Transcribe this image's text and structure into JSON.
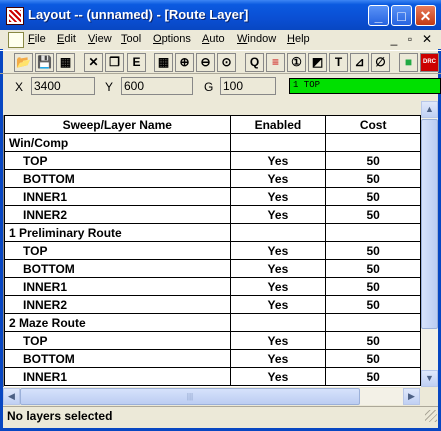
{
  "window": {
    "title": "Layout -- (unnamed) - [Route Layer]",
    "minimize_glyph": "_",
    "maximize_glyph": "□",
    "close_glyph": "✕"
  },
  "menu": {
    "items": [
      "File",
      "Edit",
      "View",
      "Tool",
      "Options",
      "Auto",
      "Window",
      "Help"
    ],
    "mdi_minimize": "_",
    "mdi_restore": "▫",
    "mdi_close": "✕"
  },
  "toolbar": {
    "tools": [
      {
        "name": "open-folder-icon",
        "glyph": "📂"
      },
      {
        "name": "save-icon",
        "glyph": "💾"
      },
      {
        "name": "print-icon",
        "glyph": "▦"
      },
      {
        "name": "cut-icon",
        "glyph": "✕"
      },
      {
        "name": "copy-icon",
        "glyph": "❐"
      },
      {
        "name": "spreadsheet-icon",
        "glyph": "E"
      },
      {
        "name": "grid-icon",
        "glyph": "▦"
      },
      {
        "name": "zoom-in-icon",
        "glyph": "⊕"
      },
      {
        "name": "zoom-out-icon",
        "glyph": "⊖"
      },
      {
        "name": "zoom-fit-icon",
        "glyph": "⊙"
      },
      {
        "name": "query-icon",
        "glyph": "Q"
      },
      {
        "name": "route-layer-icon",
        "glyph": "≡"
      },
      {
        "name": "pin-icon",
        "glyph": "①"
      },
      {
        "name": "shape-icon",
        "glyph": "◩"
      },
      {
        "name": "text-icon",
        "glyph": "T"
      },
      {
        "name": "measure-icon",
        "glyph": "⊿"
      },
      {
        "name": "no-connect-icon",
        "glyph": "∅"
      },
      {
        "name": "color-icon",
        "glyph": "■"
      },
      {
        "name": "drc-icon",
        "glyph": "DRC"
      }
    ]
  },
  "coords": {
    "x_label": "X",
    "x_value": "3400",
    "y_label": "Y",
    "y_value": "600",
    "g_label": "G",
    "g_value": "100",
    "layer": "1 TOP",
    "layer_color": "#00e000"
  },
  "table": {
    "headers": [
      "Sweep/Layer Name",
      "Enabled",
      "Cost"
    ],
    "rows": [
      {
        "name": "Win/Comp",
        "group": true,
        "enabled": "",
        "cost": ""
      },
      {
        "name": "TOP",
        "group": false,
        "enabled": "Yes",
        "cost": "50"
      },
      {
        "name": "BOTTOM",
        "group": false,
        "enabled": "Yes",
        "cost": "50"
      },
      {
        "name": "INNER1",
        "group": false,
        "enabled": "Yes",
        "cost": "50"
      },
      {
        "name": "INNER2",
        "group": false,
        "enabled": "Yes",
        "cost": "50"
      },
      {
        "name": "1 Preliminary Route",
        "group": true,
        "enabled": "",
        "cost": ""
      },
      {
        "name": "TOP",
        "group": false,
        "enabled": "Yes",
        "cost": "50"
      },
      {
        "name": "BOTTOM",
        "group": false,
        "enabled": "Yes",
        "cost": "50"
      },
      {
        "name": "INNER1",
        "group": false,
        "enabled": "Yes",
        "cost": "50"
      },
      {
        "name": "INNER2",
        "group": false,
        "enabled": "Yes",
        "cost": "50"
      },
      {
        "name": "2 Maze Route",
        "group": true,
        "enabled": "",
        "cost": ""
      },
      {
        "name": "TOP",
        "group": false,
        "enabled": "Yes",
        "cost": "50"
      },
      {
        "name": "BOTTOM",
        "group": false,
        "enabled": "Yes",
        "cost": "50"
      },
      {
        "name": "INNER1",
        "group": false,
        "enabled": "Yes",
        "cost": "50"
      }
    ]
  },
  "status": {
    "text": "No layers selected"
  }
}
